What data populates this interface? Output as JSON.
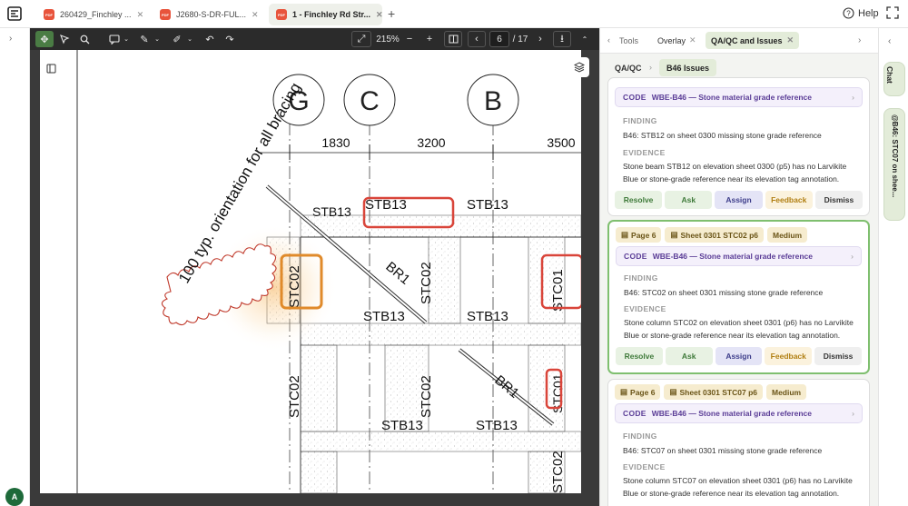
{
  "tabs": [
    {
      "label": "260429_Finchley ...",
      "icon": "pdf-icon",
      "active": false
    },
    {
      "label": "J2680-S-DR-FUL...",
      "icon": "pdf-icon",
      "active": false
    },
    {
      "label": "1 - Finchley Rd Str...",
      "icon": "pdf-icon",
      "active": true
    }
  ],
  "help_label": "Help",
  "user_initial": "A",
  "toolbar": {
    "zoom": "215%",
    "page_current": "6",
    "page_total": "/ 17"
  },
  "drawing": {
    "grid_labels": [
      "G",
      "C",
      "B"
    ],
    "dimensions": [
      "1830",
      "3200",
      "3500"
    ],
    "note": "100 typ. orientation for all bracing",
    "members": [
      "STB13",
      "STB13",
      "STB13",
      "STB13",
      "STB13",
      "STB13",
      "STB13",
      "STC02",
      "STC02",
      "STC02",
      "STC02",
      "STC01",
      "STC01",
      "STC02",
      "BR1",
      "BR1"
    ]
  },
  "panel": {
    "tabs": {
      "tools": "Tools",
      "overlay": "Overlay",
      "qa": "QA/QC and Issues"
    },
    "breadcrumb": {
      "root": "QA/QC",
      "current": "B46 Issues"
    },
    "labels": {
      "code": "CODE",
      "finding": "FINDING",
      "evidence": "EVIDENCE"
    },
    "actions": {
      "resolve": "Resolve",
      "ask": "Ask",
      "assign": "Assign",
      "feedback": "Feedback",
      "dismiss": "Dismiss"
    },
    "cards": [
      {
        "page": "",
        "sheet": "",
        "severity": "",
        "code": "WBE-B46 — Stone material grade reference",
        "finding": "B46: STB12 on sheet 0300 missing stone grade reference",
        "evidence": "Stone beam STB12 on elevation sheet 0300 (p5) has no Larvikite Blue or stone-grade reference near its elevation tag annotation."
      },
      {
        "page": "Page 6",
        "sheet": "Sheet 0301 STC02 p6",
        "severity": "Medium",
        "code": "WBE-B46 — Stone material grade reference",
        "finding": "B46: STC02 on sheet 0301 missing stone grade reference",
        "evidence": "Stone column STC02 on elevation sheet 0301 (p6) has no Larvikite Blue or stone-grade reference near its elevation tag annotation."
      },
      {
        "page": "Page 6",
        "sheet": "Sheet 0301 STC07 p6",
        "severity": "Medium",
        "code": "WBE-B46 — Stone material grade reference",
        "finding": "B46: STC07 on sheet 0301 missing stone grade reference",
        "evidence": "Stone column STC07 on elevation sheet 0301 (p6) has no Larvikite Blue or stone-grade reference near its elevation tag annotation."
      }
    ]
  },
  "right_rail": {
    "chat": "Chat",
    "b46": "@B46: STC07 on shee..."
  },
  "colors": {
    "accent_green": "#7fbf6f",
    "code_purple": "#5a3c96",
    "highlight_red": "#d9453a",
    "highlight_orange": "#e08a2a"
  }
}
